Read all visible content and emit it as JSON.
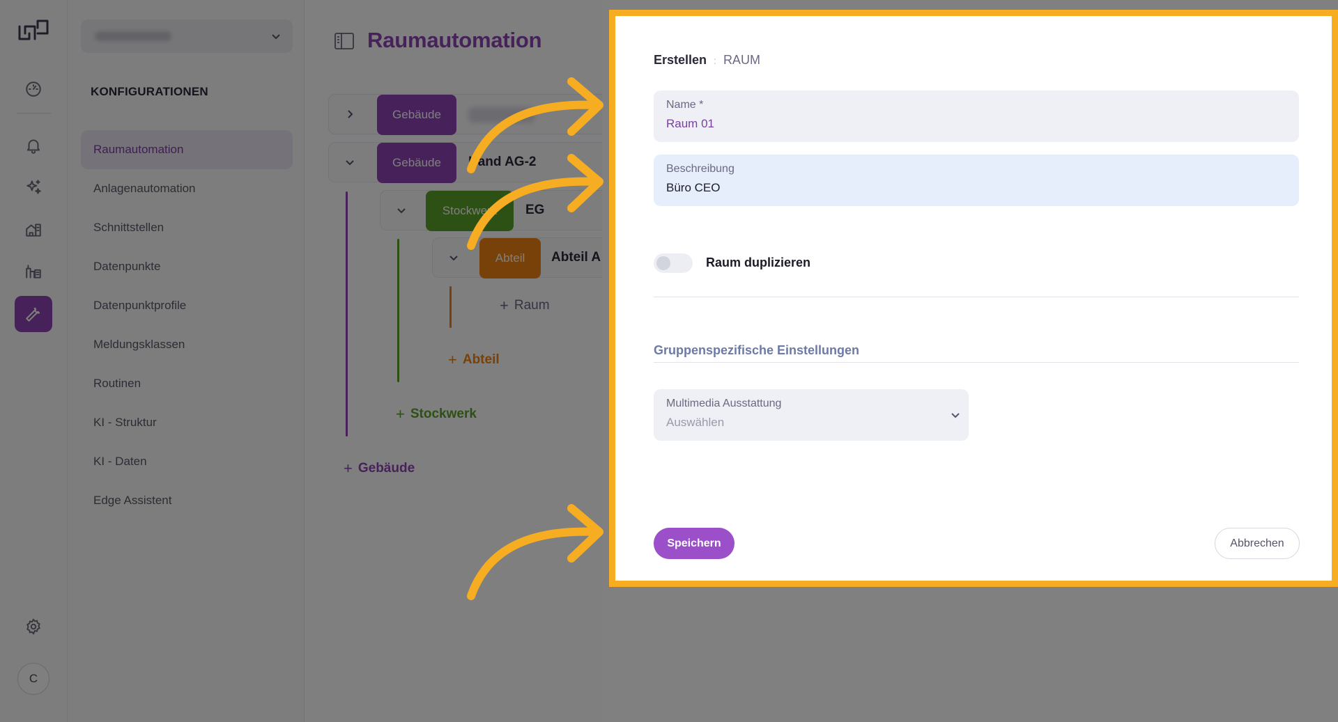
{
  "rail": {
    "items": [
      {
        "icon": "dashboard-gauge-icon"
      },
      {
        "icon": "bell-icon"
      },
      {
        "icon": "sparkles-icon"
      },
      {
        "icon": "building-automation-icon"
      },
      {
        "icon": "plant-automation-icon"
      },
      {
        "icon": "wrench-icon",
        "active": true
      },
      {
        "icon": "gear-icon"
      }
    ],
    "user_initial": "C"
  },
  "sidebar": {
    "heading": "KONFIGURATIONEN",
    "items": [
      {
        "label": "Raumautomation",
        "active": true
      },
      {
        "label": "Anlagenautomation"
      },
      {
        "label": "Schnittstellen"
      },
      {
        "label": "Datenpunkte"
      },
      {
        "label": "Datenpunktprofile"
      },
      {
        "label": "Meldungsklassen"
      },
      {
        "label": "Routinen"
      },
      {
        "label": "KI - Struktur"
      },
      {
        "label": "KI - Daten"
      },
      {
        "label": "Edge Assistent"
      }
    ]
  },
  "main": {
    "title": "Raumautomation",
    "tree": {
      "building_1_tag": "Gebäude",
      "building_2_tag": "Gebäude",
      "building_2_name": "Hand AG-2",
      "floor_tag": "Stockwerk",
      "floor_name": "EG",
      "department_tag": "Abteil",
      "department_name": "Abteil A",
      "add_room": "Raum",
      "add_department": "Abteil",
      "add_floor": "Stockwerk",
      "add_building": "Gebäude"
    },
    "colors": {
      "building": "#8e44b5",
      "floor": "#5aa12b",
      "department": "#ef8312"
    }
  },
  "modal": {
    "breadcrumb_action": "Erstellen",
    "breadcrumb_separator": ":",
    "breadcrumb_type": "RAUM",
    "name_label": "Name *",
    "name_value": "Raum 01",
    "description_label": "Beschreibung",
    "description_value": "Büro CEO",
    "duplicate_label": "Raum duplizieren",
    "duplicate_enabled": false,
    "group_settings_heading": "Gruppenspezifische Einstellungen",
    "multimedia_label": "Multimedia Ausstattung",
    "multimedia_placeholder": "Auswählen",
    "save_label": "Speichern",
    "cancel_label": "Abbrechen",
    "highlight_color": "#f7ad21"
  }
}
